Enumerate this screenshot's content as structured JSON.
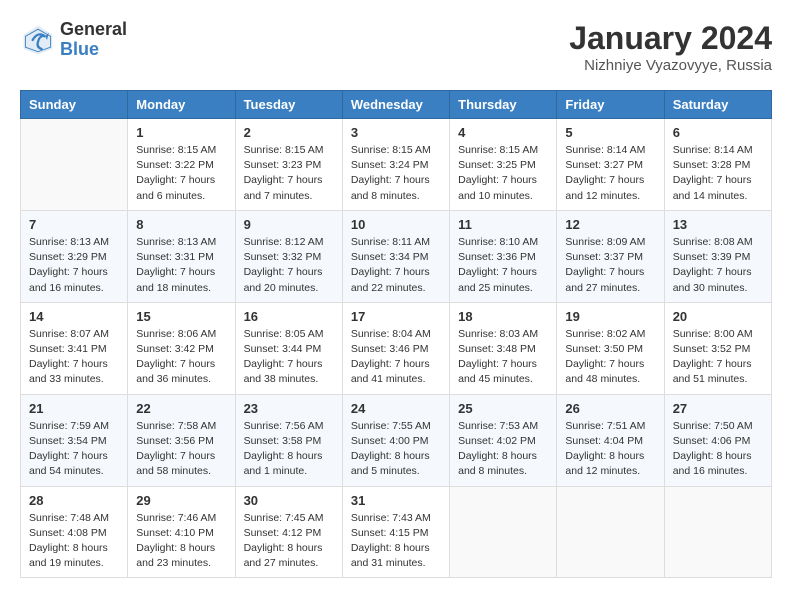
{
  "header": {
    "logo_general": "General",
    "logo_blue": "Blue",
    "month_title": "January 2024",
    "subtitle": "Nizhniye Vyazovyye, Russia"
  },
  "weekdays": [
    "Sunday",
    "Monday",
    "Tuesday",
    "Wednesday",
    "Thursday",
    "Friday",
    "Saturday"
  ],
  "weeks": [
    [
      {
        "day": "",
        "info": ""
      },
      {
        "day": "1",
        "info": "Sunrise: 8:15 AM\nSunset: 3:22 PM\nDaylight: 7 hours\nand 6 minutes."
      },
      {
        "day": "2",
        "info": "Sunrise: 8:15 AM\nSunset: 3:23 PM\nDaylight: 7 hours\nand 7 minutes."
      },
      {
        "day": "3",
        "info": "Sunrise: 8:15 AM\nSunset: 3:24 PM\nDaylight: 7 hours\nand 8 minutes."
      },
      {
        "day": "4",
        "info": "Sunrise: 8:15 AM\nSunset: 3:25 PM\nDaylight: 7 hours\nand 10 minutes."
      },
      {
        "day": "5",
        "info": "Sunrise: 8:14 AM\nSunset: 3:27 PM\nDaylight: 7 hours\nand 12 minutes."
      },
      {
        "day": "6",
        "info": "Sunrise: 8:14 AM\nSunset: 3:28 PM\nDaylight: 7 hours\nand 14 minutes."
      }
    ],
    [
      {
        "day": "7",
        "info": "Sunrise: 8:13 AM\nSunset: 3:29 PM\nDaylight: 7 hours\nand 16 minutes."
      },
      {
        "day": "8",
        "info": "Sunrise: 8:13 AM\nSunset: 3:31 PM\nDaylight: 7 hours\nand 18 minutes."
      },
      {
        "day": "9",
        "info": "Sunrise: 8:12 AM\nSunset: 3:32 PM\nDaylight: 7 hours\nand 20 minutes."
      },
      {
        "day": "10",
        "info": "Sunrise: 8:11 AM\nSunset: 3:34 PM\nDaylight: 7 hours\nand 22 minutes."
      },
      {
        "day": "11",
        "info": "Sunrise: 8:10 AM\nSunset: 3:36 PM\nDaylight: 7 hours\nand 25 minutes."
      },
      {
        "day": "12",
        "info": "Sunrise: 8:09 AM\nSunset: 3:37 PM\nDaylight: 7 hours\nand 27 minutes."
      },
      {
        "day": "13",
        "info": "Sunrise: 8:08 AM\nSunset: 3:39 PM\nDaylight: 7 hours\nand 30 minutes."
      }
    ],
    [
      {
        "day": "14",
        "info": "Sunrise: 8:07 AM\nSunset: 3:41 PM\nDaylight: 7 hours\nand 33 minutes."
      },
      {
        "day": "15",
        "info": "Sunrise: 8:06 AM\nSunset: 3:42 PM\nDaylight: 7 hours\nand 36 minutes."
      },
      {
        "day": "16",
        "info": "Sunrise: 8:05 AM\nSunset: 3:44 PM\nDaylight: 7 hours\nand 38 minutes."
      },
      {
        "day": "17",
        "info": "Sunrise: 8:04 AM\nSunset: 3:46 PM\nDaylight: 7 hours\nand 41 minutes."
      },
      {
        "day": "18",
        "info": "Sunrise: 8:03 AM\nSunset: 3:48 PM\nDaylight: 7 hours\nand 45 minutes."
      },
      {
        "day": "19",
        "info": "Sunrise: 8:02 AM\nSunset: 3:50 PM\nDaylight: 7 hours\nand 48 minutes."
      },
      {
        "day": "20",
        "info": "Sunrise: 8:00 AM\nSunset: 3:52 PM\nDaylight: 7 hours\nand 51 minutes."
      }
    ],
    [
      {
        "day": "21",
        "info": "Sunrise: 7:59 AM\nSunset: 3:54 PM\nDaylight: 7 hours\nand 54 minutes."
      },
      {
        "day": "22",
        "info": "Sunrise: 7:58 AM\nSunset: 3:56 PM\nDaylight: 7 hours\nand 58 minutes."
      },
      {
        "day": "23",
        "info": "Sunrise: 7:56 AM\nSunset: 3:58 PM\nDaylight: 8 hours\nand 1 minute."
      },
      {
        "day": "24",
        "info": "Sunrise: 7:55 AM\nSunset: 4:00 PM\nDaylight: 8 hours\nand 5 minutes."
      },
      {
        "day": "25",
        "info": "Sunrise: 7:53 AM\nSunset: 4:02 PM\nDaylight: 8 hours\nand 8 minutes."
      },
      {
        "day": "26",
        "info": "Sunrise: 7:51 AM\nSunset: 4:04 PM\nDaylight: 8 hours\nand 12 minutes."
      },
      {
        "day": "27",
        "info": "Sunrise: 7:50 AM\nSunset: 4:06 PM\nDaylight: 8 hours\nand 16 minutes."
      }
    ],
    [
      {
        "day": "28",
        "info": "Sunrise: 7:48 AM\nSunset: 4:08 PM\nDaylight: 8 hours\nand 19 minutes."
      },
      {
        "day": "29",
        "info": "Sunrise: 7:46 AM\nSunset: 4:10 PM\nDaylight: 8 hours\nand 23 minutes."
      },
      {
        "day": "30",
        "info": "Sunrise: 7:45 AM\nSunset: 4:12 PM\nDaylight: 8 hours\nand 27 minutes."
      },
      {
        "day": "31",
        "info": "Sunrise: 7:43 AM\nSunset: 4:15 PM\nDaylight: 8 hours\nand 31 minutes."
      },
      {
        "day": "",
        "info": ""
      },
      {
        "day": "",
        "info": ""
      },
      {
        "day": "",
        "info": ""
      }
    ]
  ]
}
